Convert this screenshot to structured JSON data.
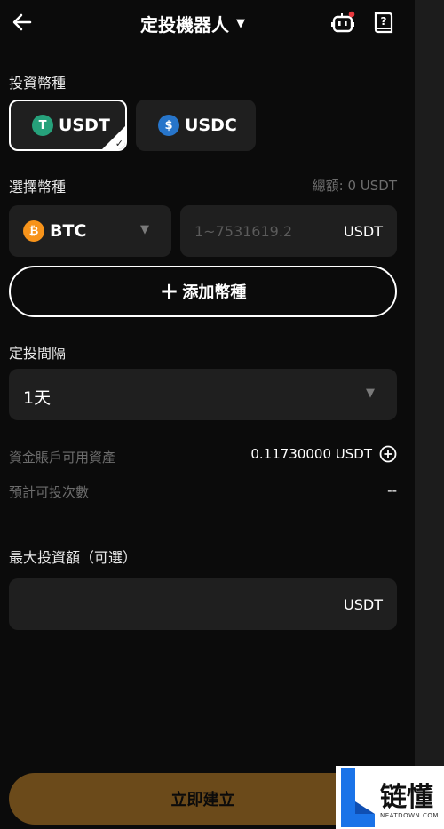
{
  "header": {
    "title": "定投機器人"
  },
  "invest_coin": {
    "label": "投資幣種",
    "options": [
      {
        "label": "USDT",
        "icon": "tether-icon",
        "color": "#26a17b",
        "selected": true
      },
      {
        "label": "USDC",
        "icon": "usdc-icon",
        "color": "#2775ca",
        "selected": false
      }
    ]
  },
  "select_coin": {
    "label": "選擇幣種",
    "total": "總額: 0 USDT",
    "coin": "BTC",
    "coin_color": "#f7931a",
    "amount_placeholder": "1~7531619.2",
    "amount_unit": "USDT",
    "add_label": "添加幣種"
  },
  "interval": {
    "label": "定投間隔",
    "value": "1天"
  },
  "info": {
    "available_label": "資金賬戶可用資產",
    "available_value": "0.11730000 USDT",
    "times_label": "預計可投次數",
    "times_value": "--"
  },
  "max_invest": {
    "label": "最大投資額（可選）",
    "unit": "USDT"
  },
  "submit": {
    "label": "立即建立"
  },
  "watermark": {
    "text": "链懂",
    "sub": "NEATDOWN.COM"
  }
}
